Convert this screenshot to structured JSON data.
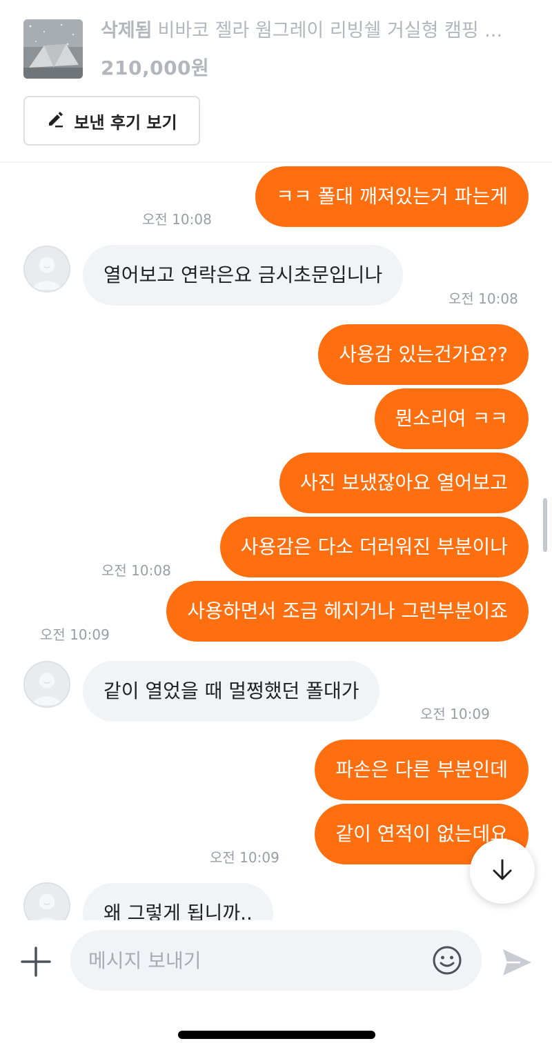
{
  "product": {
    "status": "삭제됨",
    "title": "비바코 젤라 웜그레이 리빙쉘 거실형 캠핑 ...",
    "price": "210,000원",
    "review_button": "보낸 후기 보기"
  },
  "messages": [
    {
      "text": "ㅋㅋ 폴대 깨져있는거 파는게",
      "time": "오전 10:08"
    },
    {
      "text": "열어보고 연락은요 금시초문입니나",
      "time": "오전 10:08"
    },
    {
      "text": "사용감 있는건가요??"
    },
    {
      "text": "뭔소리여 ㅋㅋ"
    },
    {
      "text": "사진 보냈잖아요 열어보고"
    },
    {
      "text": "사용감은 다소 더러워진 부분이나",
      "time": "오전 10:08"
    },
    {
      "text": "사용하면서 조금 헤지거나 그런부분이죠",
      "time": "오전 10:09"
    },
    {
      "text": "같이 열었을 때 멀쩡했던 폴대가",
      "time": "오전 10:09"
    },
    {
      "text": "파손은 다른 부분인데"
    },
    {
      "text": "같이 연적이 없는데요",
      "time": "오전 10:09"
    },
    {
      "text": "왜 그렇게 됩니까.."
    }
  ],
  "input": {
    "placeholder": "메시지 보내기"
  },
  "icons": {
    "review": "pencil-icon",
    "add": "plus-icon",
    "emoji": "smiley-icon",
    "send": "send-icon",
    "scroll": "arrow-down-icon"
  },
  "colors": {
    "accent": "#ff6f0f",
    "incoming_bubble": "#f2f3f6"
  }
}
